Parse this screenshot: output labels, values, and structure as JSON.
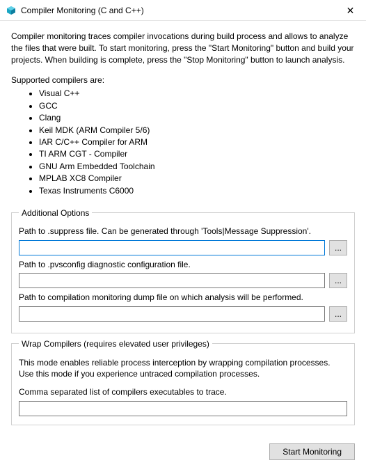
{
  "titlebar": {
    "title": "Compiler Monitoring (C and C++)",
    "close_label": "✕"
  },
  "intro_text": "Compiler monitoring traces compiler invocations during build process and allows to analyze the files that were built. To start monitoring, press the \"Start Monitoring\" button and build your projects. When building is complete, press the \"Stop Monitoring\" button to launch analysis.",
  "supported_label": "Supported compilers are:",
  "compilers": [
    "Visual C++",
    "GCC",
    "Clang",
    "Keil MDK (ARM Compiler 5/6)",
    "IAR C/C++ Compiler for ARM",
    "TI ARM CGT - Compiler",
    "GNU Arm Embedded Toolchain",
    "MPLAB XC8 Compiler",
    "Texas Instruments C6000"
  ],
  "additional_options": {
    "legend": "Additional Options",
    "suppress_label": "Path to .suppress file. Can be generated through 'Tools|Message Suppression'.",
    "suppress_value": "",
    "pvsconfig_label": "Path to .pvsconfig diagnostic configuration file.",
    "pvsconfig_value": "",
    "dump_label": "Path to compilation monitoring dump file on which analysis will be performed.",
    "dump_value": "",
    "browse_label": "..."
  },
  "wrap_compilers": {
    "legend": "Wrap Compilers (requires elevated user privileges)",
    "description": "This mode enables reliable process interception by wrapping compilation processes. Use this mode if you experience untraced compilation processes.",
    "list_label": "Comma separated list of compilers executables to trace.",
    "list_value": ""
  },
  "footer": {
    "start_label": "Start Monitoring"
  }
}
